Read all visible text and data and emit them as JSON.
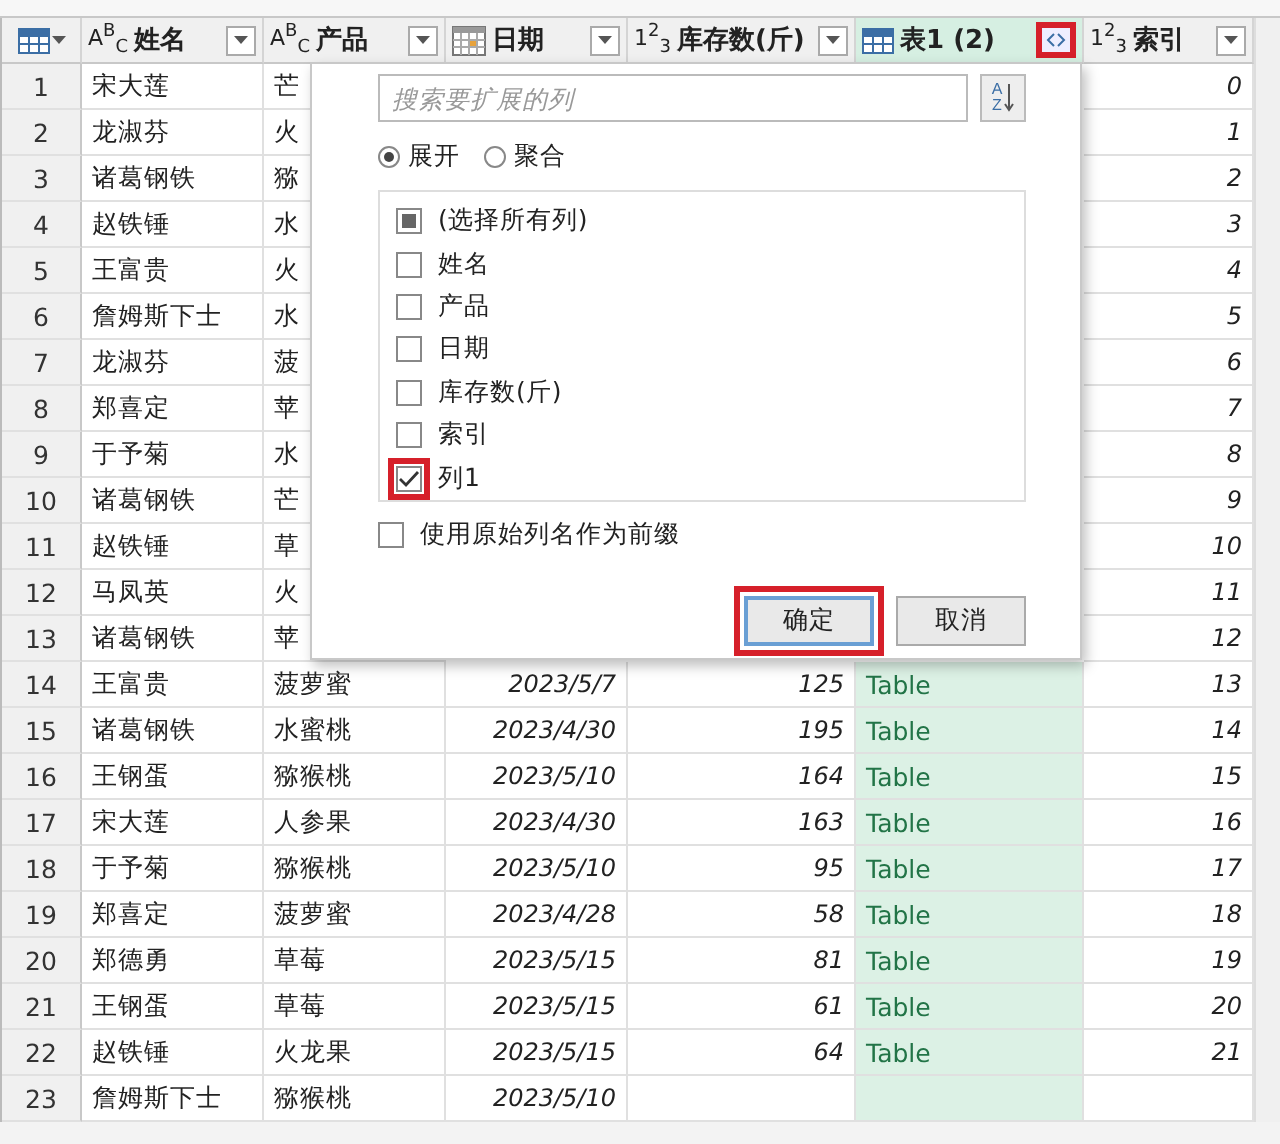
{
  "columns": [
    {
      "label": "姓名",
      "kind": "glyph",
      "type_glyph": "A$^{B}$$_{C}$"
    },
    {
      "label": "产品",
      "kind": "glyph",
      "type_glyph": "A$^{B}$$_{C}$"
    },
    {
      "label": "日期",
      "kind": "date"
    },
    {
      "label": "库存数(斤)",
      "kind": "glyph",
      "type_glyph": "1$^{2}$$_{3}$"
    },
    {
      "label": "表1 (2)",
      "kind": "table",
      "expand_highlighted": true
    },
    {
      "label": "索引",
      "kind": "glyph",
      "type_glyph": "1$^{2}$$_{3}$"
    }
  ],
  "rows": [
    {
      "num": "1",
      "name": "宋大莲",
      "product": "芒",
      "index": "0"
    },
    {
      "num": "2",
      "name": "龙淑芬",
      "product": "火",
      "index": "1"
    },
    {
      "num": "3",
      "name": "诸葛钢铁",
      "product": "猕",
      "index": "2"
    },
    {
      "num": "4",
      "name": "赵铁锤",
      "product": "水",
      "index": "3"
    },
    {
      "num": "5",
      "name": "王富贵",
      "product": "火",
      "index": "4"
    },
    {
      "num": "6",
      "name": "詹姆斯下士",
      "product": "水",
      "index": "5"
    },
    {
      "num": "7",
      "name": "龙淑芬",
      "product": "菠",
      "index": "6"
    },
    {
      "num": "8",
      "name": "郑喜定",
      "product": "苹",
      "index": "7"
    },
    {
      "num": "9",
      "name": "于予菊",
      "product": "水",
      "index": "8"
    },
    {
      "num": "10",
      "name": "诸葛钢铁",
      "product": "芒",
      "index": "9"
    },
    {
      "num": "11",
      "name": "赵铁锤",
      "product": "草",
      "index": "10"
    },
    {
      "num": "12",
      "name": "马凤英",
      "product": "火",
      "index": "11"
    },
    {
      "num": "13",
      "name": "诸葛钢铁",
      "product": "苹",
      "index": "12"
    },
    {
      "num": "14",
      "name": "王富贵",
      "product": "菠萝蜜",
      "date": "2023/5/7",
      "qty": "125",
      "table": "Table",
      "index": "13"
    },
    {
      "num": "15",
      "name": "诸葛钢铁",
      "product": "水蜜桃",
      "date": "2023/4/30",
      "qty": "195",
      "table": "Table",
      "index": "14"
    },
    {
      "num": "16",
      "name": "王钢蛋",
      "product": "猕猴桃",
      "date": "2023/5/10",
      "qty": "164",
      "table": "Table",
      "index": "15"
    },
    {
      "num": "17",
      "name": "宋大莲",
      "product": "人参果",
      "date": "2023/4/30",
      "qty": "163",
      "table": "Table",
      "index": "16"
    },
    {
      "num": "18",
      "name": "于予菊",
      "product": "猕猴桃",
      "date": "2023/5/10",
      "qty": "95",
      "table": "Table",
      "index": "17"
    },
    {
      "num": "19",
      "name": "郑喜定",
      "product": "菠萝蜜",
      "date": "2023/4/28",
      "qty": "58",
      "table": "Table",
      "index": "18"
    },
    {
      "num": "20",
      "name": "郑德勇",
      "product": "草莓",
      "date": "2023/5/15",
      "qty": "81",
      "table": "Table",
      "index": "19"
    },
    {
      "num": "21",
      "name": "王钢蛋",
      "product": "草莓",
      "date": "2023/5/15",
      "qty": "61",
      "table": "Table",
      "index": "20"
    },
    {
      "num": "22",
      "name": "赵铁锤",
      "product": "火龙果",
      "date": "2023/5/15",
      "qty": "64",
      "table": "Table",
      "index": "21"
    },
    {
      "num": "23",
      "name": "詹姆斯下士",
      "product": "猕猴桃",
      "date": "2023/5/10"
    }
  ],
  "popup": {
    "search_placeholder": "搜索要扩展的列",
    "sort_label": "AZ",
    "modes": [
      {
        "label": "展开",
        "selected": true
      },
      {
        "label": "聚合",
        "selected": false
      }
    ],
    "items": [
      {
        "label": "(选择所有列)",
        "checked": false,
        "indeterminate": true,
        "highlighted": false
      },
      {
        "label": "姓名",
        "checked": false,
        "indeterminate": false,
        "highlighted": false
      },
      {
        "label": "产品",
        "checked": false,
        "indeterminate": false,
        "highlighted": false
      },
      {
        "label": "日期",
        "checked": false,
        "indeterminate": false,
        "highlighted": false
      },
      {
        "label": "库存数(斤)",
        "checked": false,
        "indeterminate": false,
        "highlighted": false
      },
      {
        "label": "索引",
        "checked": false,
        "indeterminate": false,
        "highlighted": false
      },
      {
        "label": "列1",
        "checked": true,
        "indeterminate": false,
        "highlighted": true
      }
    ],
    "prefix": {
      "label": "使用原始列名作为前缀",
      "checked": false
    },
    "buttons": [
      {
        "label": "确定",
        "default": true,
        "highlighted": true
      },
      {
        "label": "取消",
        "default": false,
        "highlighted": false
      }
    ]
  }
}
